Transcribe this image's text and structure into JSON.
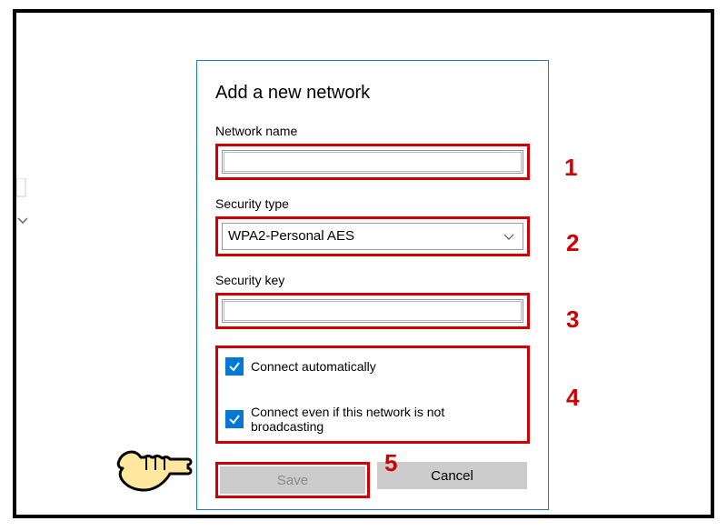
{
  "dialog": {
    "title": "Add a new network",
    "network_name": {
      "label": "Network name",
      "value": ""
    },
    "security_type": {
      "label": "Security type",
      "selected": "WPA2-Personal AES"
    },
    "security_key": {
      "label": "Security key",
      "value": ""
    },
    "connect_auto": {
      "label": "Connect automatically",
      "checked": true
    },
    "connect_hidden": {
      "label": "Connect even if this network is not broadcasting",
      "checked": true
    },
    "save_label": "Save",
    "cancel_label": "Cancel"
  },
  "annotations": {
    "n1": "1",
    "n2": "2",
    "n3": "3",
    "n4": "4",
    "n5": "5"
  },
  "colors": {
    "highlight": "#d00000",
    "accent": "#0078d7",
    "dialog_border": "#1a7cc0"
  }
}
